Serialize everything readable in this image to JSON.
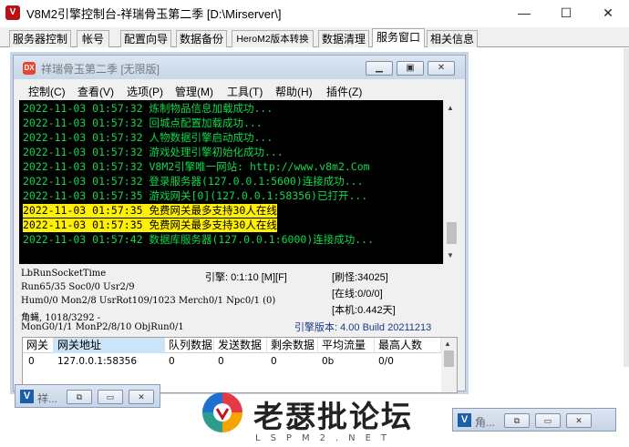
{
  "window": {
    "logo_text": "V",
    "title": "V8M2引擎控制台-祥瑞骨玉第二季 [D:\\Mirserver\\]",
    "controls": {
      "minimize": "—",
      "maximize": "☐",
      "close": "✕"
    }
  },
  "tabs": [
    {
      "label": "服务器控制",
      "active": false
    },
    {
      "label": "帐号",
      "active": false
    },
    {
      "label": "配置向导",
      "active": false
    },
    {
      "label": "数据备份",
      "active": false
    },
    {
      "label": "HeroM2版本转换",
      "active": false
    },
    {
      "label": "数据清理",
      "active": false
    },
    {
      "label": "服务窗口",
      "active": true
    },
    {
      "label": "相关信息",
      "active": false
    }
  ],
  "mdi": {
    "icon_text": "DX",
    "title": "祥瑞骨玉第二季 [无限版]",
    "menu": [
      "控制(C)",
      "查看(V)",
      "选项(P)",
      "管理(M)",
      "工具(T)",
      "帮助(H)",
      "插件(Z)"
    ],
    "console_lines": [
      {
        "text": "2022-11-03 01:57:32 炼制物品信息加载成功...",
        "highlight": false
      },
      {
        "text": "2022-11-03 01:57:32 回城点配置加载成功...",
        "highlight": false
      },
      {
        "text": "2022-11-03 01:57:32 人物数据引擎启动成功...",
        "highlight": false
      },
      {
        "text": "2022-11-03 01:57:32 游戏处理引擎初始化成功...",
        "highlight": false
      },
      {
        "text": "2022-11-03 01:57:32 V8M2引擎唯一网站: http://www.v8m2.Com",
        "highlight": false
      },
      {
        "text": "2022-11-03 01:57:32 登录服务器(127.0.0.1:5600)连接成功...",
        "highlight": false
      },
      {
        "text": "2022-11-03 01:57:35 游戏网关[0](127.0.0.1:58356)已打开...",
        "highlight": false
      },
      {
        "text": "2022-11-03 01:57:35 免费网关最多支持30人在线",
        "highlight": true
      },
      {
        "text": "2022-11-03 01:57:35 免费网关最多支持30人在线",
        "highlight": true
      },
      {
        "text": "2022-11-03 01:57:42 数据库服务器(127.0.0.1:6000)连接成功...",
        "highlight": false
      }
    ],
    "info": {
      "l1": "LbRunSocketTime",
      "l2": "Run65/35 Soc0/0 Usr2/9",
      "l3": "Hum0/0 Mon2/8 UsrRot109/1023 Merch0/1 Npc0/1 (0)",
      "l4": "角蝇, 1018/3292 -",
      "l5": "MonG0/1/1 MonP2/8/10 ObjRun0/1",
      "engine": "引擎: 0:1:10 [M][F]",
      "version": "引擎版本: 4.00 Build 20211213",
      "refresh": "[刷怪:34025]",
      "online": "[在线:0/0/0]",
      "local": "[本机:0.442天]"
    },
    "gateway_table": {
      "headers": [
        "网关",
        "网关地址",
        "队列数据",
        "发送数据",
        "剩余数据",
        "平均流量",
        "最高人数"
      ],
      "rows": [
        [
          "0",
          "127.0.0.1:58356",
          "0",
          "0",
          "0",
          "0b",
          "0/0"
        ]
      ]
    }
  },
  "minimized": [
    {
      "icon": "V",
      "title": "祥..."
    },
    {
      "icon": "V",
      "title": "角..."
    }
  ],
  "watermark": {
    "text": "老瑟批论坛",
    "sub": "LSPM2.NET"
  }
}
